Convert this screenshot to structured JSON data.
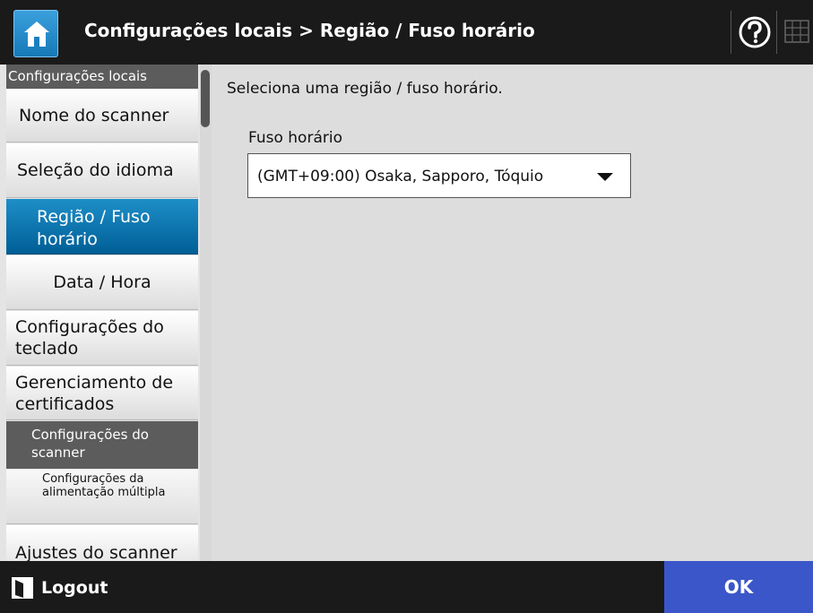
{
  "header": {
    "title": "Configurações locais > Região / Fuso horário",
    "home_icon": "home-icon",
    "help_icon": "help-icon",
    "keyboard_icon": "keyboard-icon"
  },
  "sidebar": {
    "section_title": "Configurações locais",
    "items": [
      {
        "label": "Nome do scanner"
      },
      {
        "label": "Seleção do idioma"
      },
      {
        "label": "Região / Fuso horário"
      },
      {
        "label": "Data / Hora"
      },
      {
        "label": "Configurações do teclado"
      },
      {
        "label": "Gerenciamento de certificados"
      }
    ],
    "group_title": "Configurações do scanner",
    "sub_items": [
      {
        "label": "Configurações da alimentação múltipla"
      },
      {
        "label": "Ajustes do scanner"
      }
    ]
  },
  "main": {
    "instruction": "Seleciona uma região / fuso horário.",
    "timezone": {
      "label": "Fuso horário",
      "selected": "(GMT+09:00) Osaka, Sapporo, Tóquio"
    }
  },
  "footer": {
    "logout_label": "Logout",
    "ok_label": "OK"
  },
  "colors": {
    "header_bg": "#1a1a1a",
    "selected_item": "#0a76b3",
    "ok_button": "#3b56c8",
    "main_bg": "#dddddd"
  }
}
